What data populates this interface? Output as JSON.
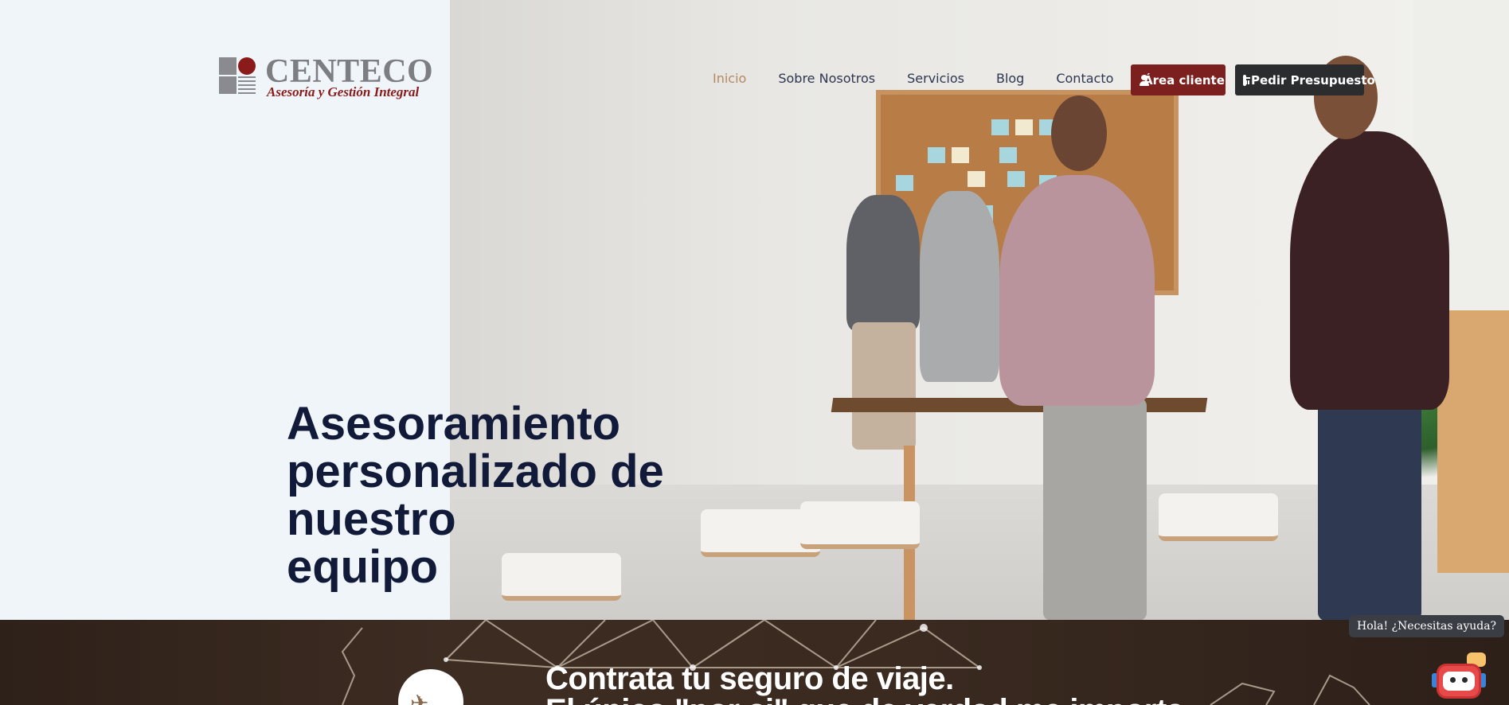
{
  "logo": {
    "name": "CENTECO",
    "tagline": "Asesoría y Gestión Integral"
  },
  "nav": {
    "items": [
      {
        "label": "Inicio",
        "active": true
      },
      {
        "label": "Sobre Nosotros",
        "active": false
      },
      {
        "label": "Servicios",
        "active": false
      },
      {
        "label": "Blog",
        "active": false
      },
      {
        "label": "Contacto",
        "active": false
      }
    ]
  },
  "actions": {
    "client_area_label": "Área cliente",
    "client_area_icon": "user-icon",
    "quote_label": "Pedir Presupuesto",
    "quote_icon": "calculator-icon"
  },
  "hero": {
    "headline_line1": "Asesoramiento",
    "headline_line2": "personalizado de nuestro",
    "headline_line3": "equipo"
  },
  "banner": {
    "icon": "airplane-icon",
    "title": "Contrata tu seguro de viaje.",
    "subtitle": "El único \"por si\" que de verdad me importa"
  },
  "chat": {
    "bubble_text": "Hola! ¿Necesitas ayuda?",
    "icon": "robot-icon"
  },
  "colors": {
    "brand_red": "#7c1f1f",
    "nav_active": "#b48a62",
    "headline": "#121a3a",
    "dark_button": "#2a2c2e",
    "banner_bg": "#3b2b22"
  }
}
